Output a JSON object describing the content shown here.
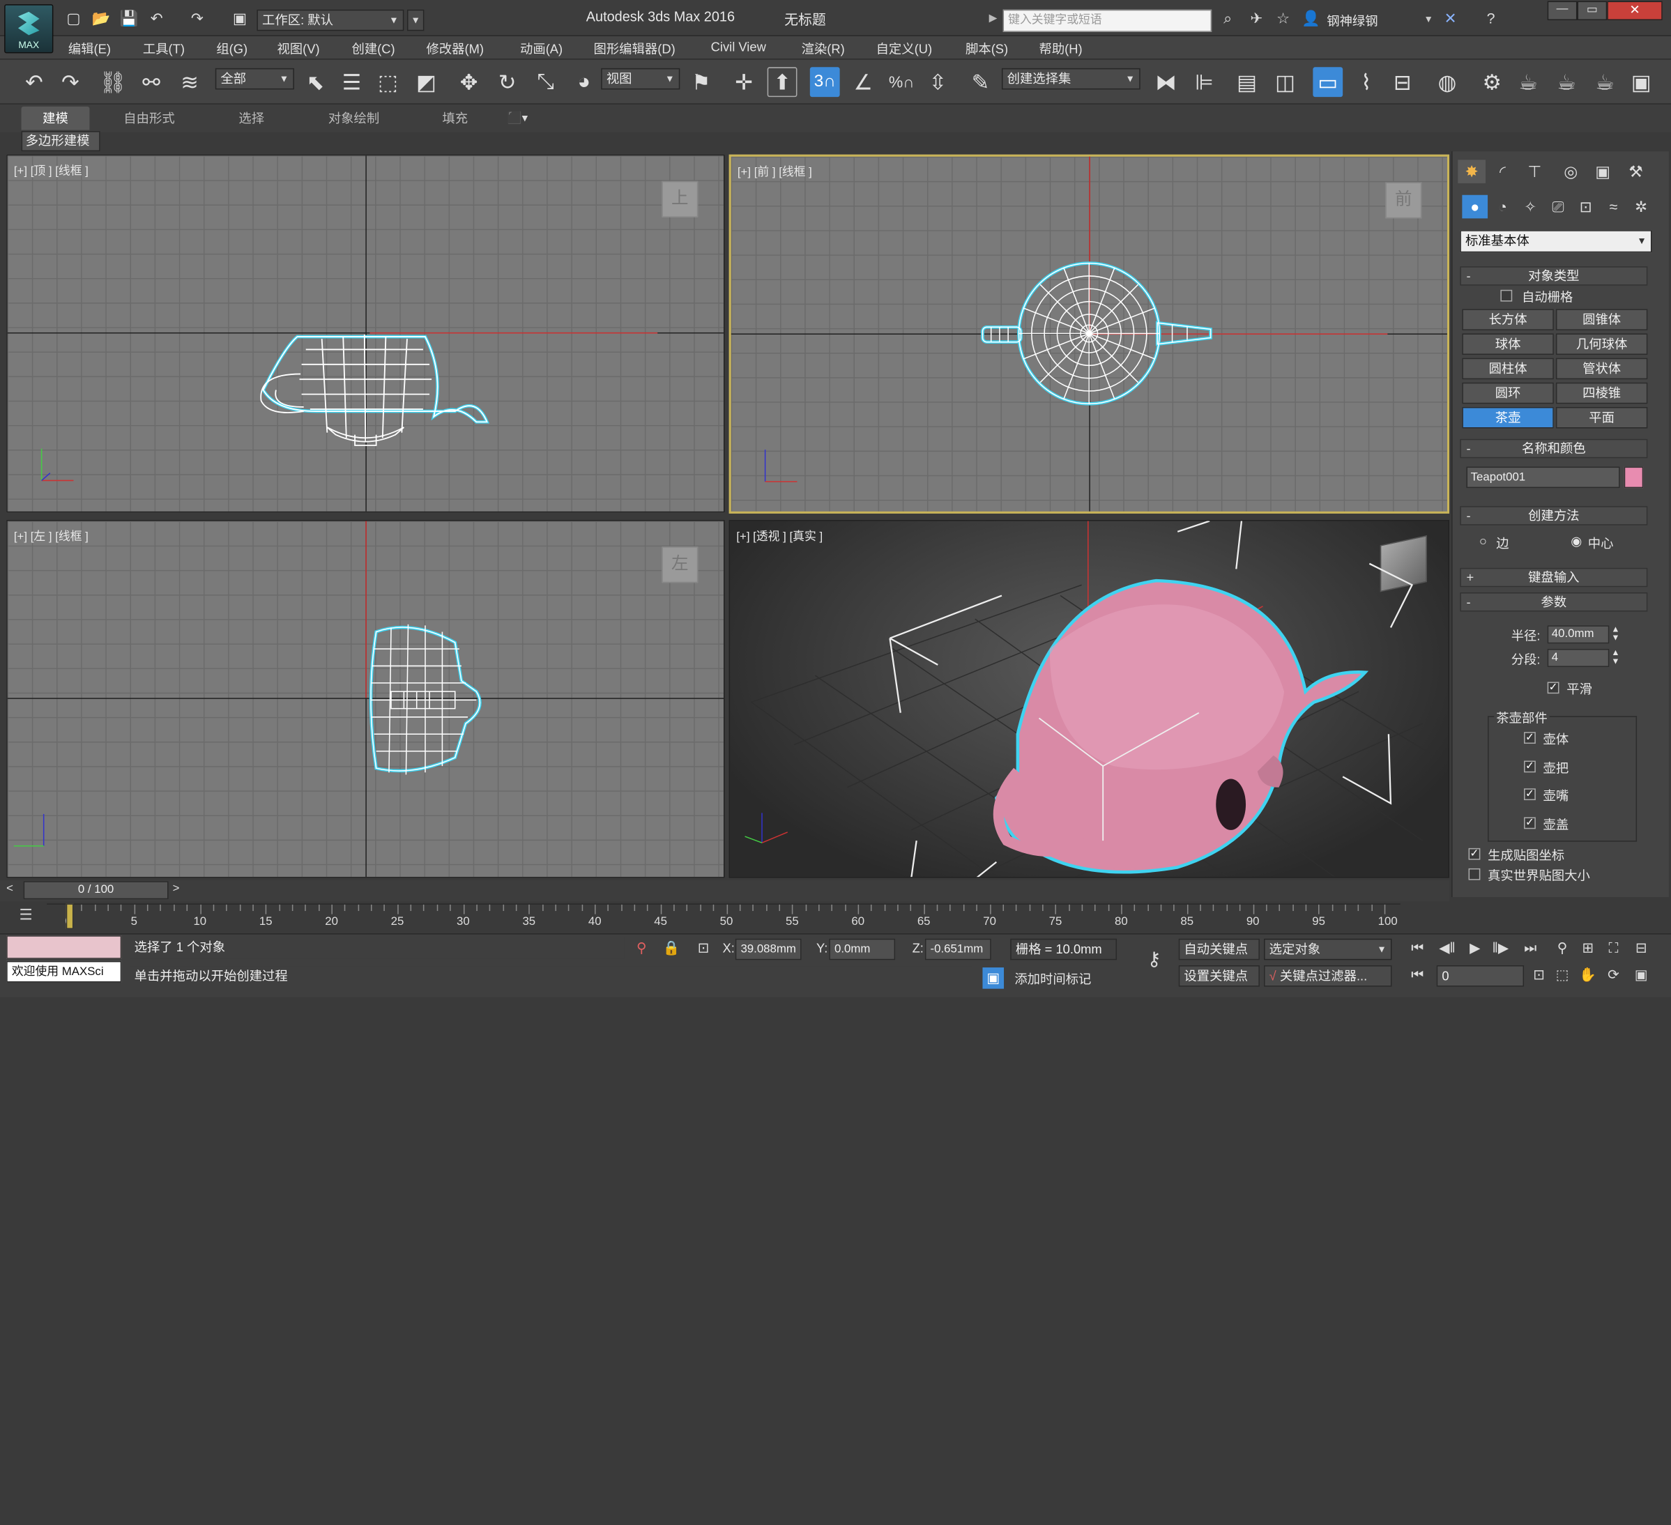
{
  "titlebar": {
    "logo_text": "MAX",
    "workspace_label": "工作区: 默认",
    "app_title": "Autodesk 3ds Max 2016",
    "doc_title": "无标题",
    "search_placeholder": "键入关键字或短语",
    "user": "钢神绿钢"
  },
  "menu": [
    "编辑(E)",
    "工具(T)",
    "组(G)",
    "视图(V)",
    "创建(C)",
    "修改器(M)",
    "动画(A)",
    "图形编辑器(D)",
    "Civil View",
    "渲染(R)",
    "自定义(U)",
    "脚本(S)",
    "帮助(H)"
  ],
  "toolbar": {
    "selection_filter": "全部",
    "ref_coord": "视图",
    "snap_label": "3",
    "named_selection": "创建选择集"
  },
  "ribbon": {
    "tabs": [
      "建模",
      "自由形式",
      "选择",
      "对象绘制",
      "填充"
    ],
    "active_tab": "建模",
    "sub_label": "多边形建模"
  },
  "viewports": {
    "top": {
      "label": "[+] [顶 ] [线框 ]",
      "cube": "上"
    },
    "front": {
      "label": "[+] [前 ] [线框 ]",
      "cube": "前"
    },
    "left": {
      "label": "[+] [左 ] [线框 ]",
      "cube": "左"
    },
    "perspective": {
      "label": "[+] [透视 ] [真实 ]"
    }
  },
  "command_panel": {
    "category": "标准基本体",
    "object_type": {
      "header": "对象类型",
      "autogrid": "自动栅格",
      "buttons": [
        "长方体",
        "圆锥体",
        "球体",
        "几何球体",
        "圆柱体",
        "管状体",
        "圆环",
        "四棱锥",
        "茶壶",
        "平面"
      ],
      "active": "茶壶"
    },
    "name_color": {
      "header": "名称和颜色",
      "name": "Teapot001",
      "color": "#e88cb0"
    },
    "creation_method": {
      "header": "创建方法",
      "options": [
        "边",
        "中心"
      ],
      "selected": "中心"
    },
    "keyboard_entry": {
      "header": "键盘输入"
    },
    "parameters": {
      "header": "参数",
      "radius_label": "半径:",
      "radius": "40.0mm",
      "segments_label": "分段:",
      "segments": "4",
      "smooth_label": "平滑",
      "smooth": true,
      "parts_label": "茶壶部件",
      "parts": [
        {
          "label": "壶体",
          "checked": true
        },
        {
          "label": "壶把",
          "checked": true
        },
        {
          "label": "壶嘴",
          "checked": true
        },
        {
          "label": "壶盖",
          "checked": true
        }
      ],
      "gen_map": {
        "label": "生成贴图坐标",
        "checked": true
      },
      "real_world": {
        "label": "真实世界贴图大小",
        "checked": false
      }
    }
  },
  "timeline": {
    "slider": "0 / 100",
    "ticks": [
      0,
      5,
      10,
      15,
      20,
      25,
      30,
      35,
      40,
      45,
      50,
      55,
      60,
      65,
      70,
      75,
      80,
      85,
      90,
      95,
      100
    ]
  },
  "status": {
    "welcome": "欢迎使用 MAXSci",
    "selected": "选择了 1 个对象",
    "prompt": "单击并拖动以开始创建过程",
    "x_label": "X:",
    "x": "39.088mm",
    "y_label": "Y:",
    "y": "0.0mm",
    "z_label": "Z:",
    "z": "-0.651mm",
    "grid": "栅格 = 10.0mm",
    "add_time_tag": "添加时间标记",
    "auto_key": "自动关键点",
    "set_key": "设置关键点",
    "key_mode": "选定对象",
    "key_filters": "关键点过滤器...",
    "frame": "0"
  }
}
